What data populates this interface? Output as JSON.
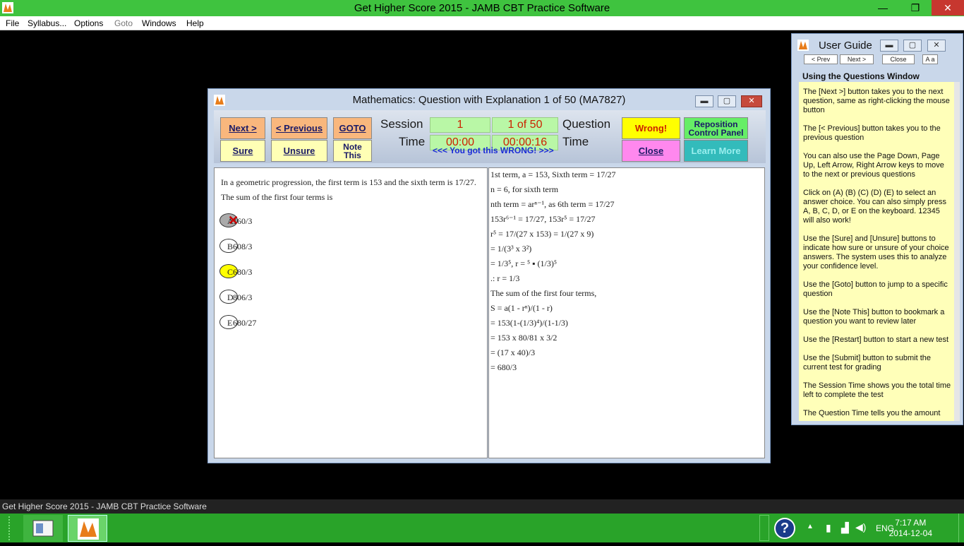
{
  "app": {
    "title": "Get Higher Score 2015 - JAMB CBT Practice Software",
    "controls": {
      "minimize": "—",
      "restore": "❐",
      "close": "✕"
    }
  },
  "menu": {
    "file": "File",
    "syllabus": "Syllabus...",
    "options": "Options",
    "goto": "Goto",
    "windows": "Windows",
    "help": "Help"
  },
  "question_window": {
    "title": "Mathematics: Question with Explanation  1 of  50 (MA7827)",
    "buttons": {
      "next": "Next >",
      "previous": "< Previous",
      "goto": "GOTO",
      "sure": "Sure",
      "unsure": "Unsure",
      "note_this_1": "Note",
      "note_this_2": "This",
      "wrong": "Wrong!",
      "close": "Close",
      "reposition_1": "Reposition",
      "reposition_2": "Control Panel",
      "learn_more": "Learn More"
    },
    "labels": {
      "session": "Session",
      "time_left": "Time",
      "question": "Question",
      "time_right": "Time"
    },
    "session_number": "1",
    "question_count": "1 of  50",
    "session_time": "00:00",
    "question_time": "00:00:16",
    "result_message": "<<<  You got this WRONG!  >>>",
    "question_text": "In a geometric progression, the first term is 153 and the sixth term is 17/27. The sum of the first four terms is",
    "options": [
      {
        "letter": "A",
        "value": "160/3",
        "state": "selected-wrong"
      },
      {
        "letter": "B",
        "value": "608/3",
        "state": "normal"
      },
      {
        "letter": "C",
        "value": "680/3",
        "state": "correct"
      },
      {
        "letter": "D",
        "value": "806/3",
        "state": "normal"
      },
      {
        "letter": "E",
        "value": "680/27",
        "state": "normal"
      }
    ],
    "explanation": [
      "1st term, a = 153, Sixth term = 17/27",
      "n = 6, for sixth term",
      "nth term = arⁿ⁻¹, as 6th term = 17/27",
      "153r⁶⁻¹ = 17/27, 153r⁵ = 17/27",
      "r⁵ = 17/(27 x 153)  = 1/(27 x 9)",
      "= 1/(3³ x 3²)",
      "= 1/3⁵, r = ⁵ ▪ (1/3)⁵",
      ".: r = 1/3",
      "The sum of the first four terms,",
      "S = a(1 - rⁿ)/(1 - r)",
      "= 153(1-(1/3)⁴)/(1-1/3)",
      "= 153 x 80/81 x 3/2",
      "= (17 x 40)/3",
      "= 680/3"
    ]
  },
  "user_guide": {
    "title": "User Guide",
    "prev": "< Prev",
    "next": "Next >",
    "close": "Close",
    "font": "A a",
    "heading": "Using the Questions Window",
    "paragraphs": [
      "The [Next >] button takes you to the next question, same as right-clicking the mouse button",
      "The [< Previous] button takes you to the previous question",
      "You can also use the Page Down, Page Up, Left Arrow, Right Arrow keys to move to the next or previous questions",
      "Click on (A) (B) (C) (D) (E) to select an answer choice. You can also simply press A, B, C, D, or E on the keyboard. 12345 will also work!",
      "Use the [Sure] and [Unsure] buttons to indicate how sure or unsure of your choice answers. The system uses this to analyze your confidence level.",
      "Use the [Goto] button to jump to a specific question",
      "Use the [Note This] button to bookmark a question you want to review later",
      "Use the [Restart] button to start a new test",
      "Use the [Submit] button to submit the current test for grading",
      "The Session Time shows you the total time left to complete the test",
      "The Question Time tells you the amount"
    ]
  },
  "status_strip": "Get Higher Score 2015 - JAMB CBT Practice Software",
  "taskbar": {
    "lang": "ENG",
    "time": "7:17 AM",
    "date": "2014-12-04"
  },
  "colors": {
    "titlebar_green": "#3fc33f",
    "taskbar_green": "#29a329",
    "orange_button": "#f9b77d",
    "yellow_button": "#ffffb5",
    "wrong_yellow": "#ffff00",
    "close_pink": "#ff88ee",
    "reposition_green": "#66ee66",
    "learn_teal": "#33bbbb",
    "timer_green": "#b9f7a6",
    "guide_yellow": "#ffffb9"
  }
}
